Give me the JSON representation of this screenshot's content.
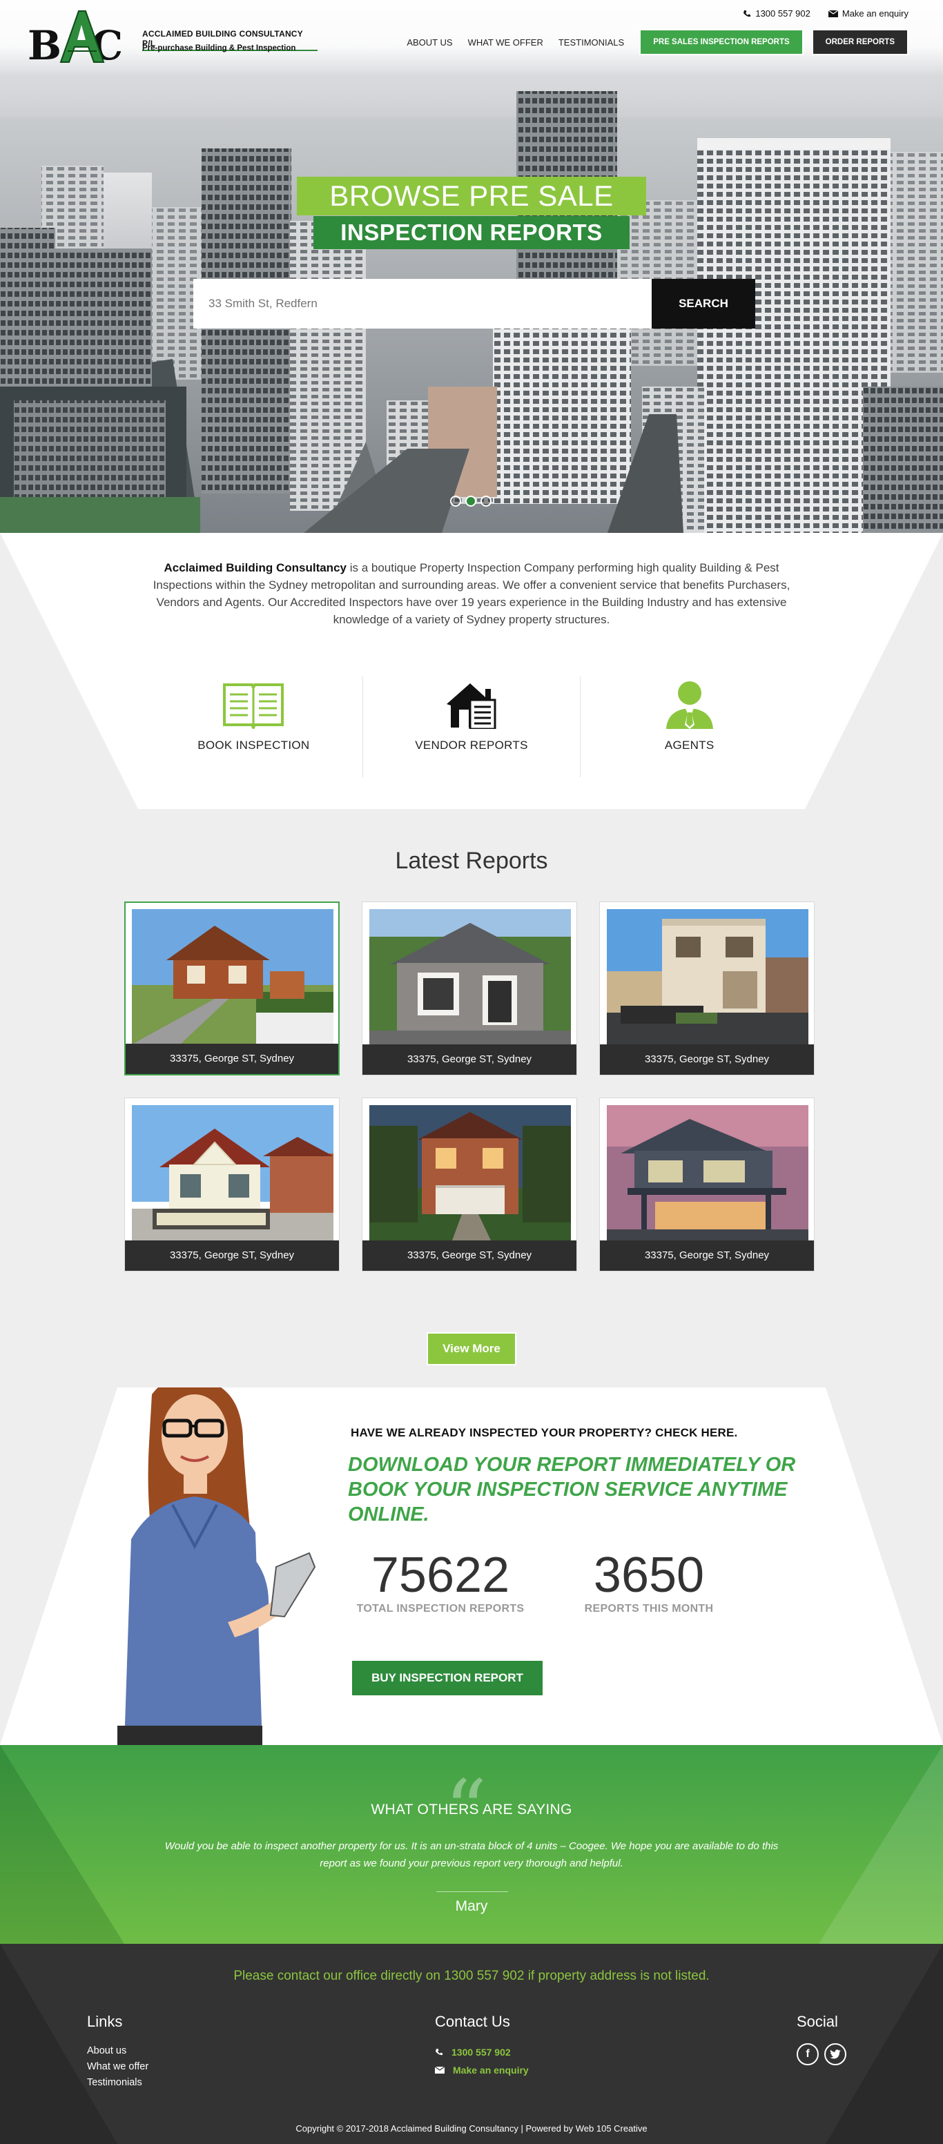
{
  "header": {
    "logo_text": "BAC",
    "company_name": "ACCLAIMED BUILDING CONSULTANCY  P/L",
    "tagline": "Pre-purchase Building & Pest Inspection",
    "phone": "1300 557 902",
    "enquiry": "Make an enquiry",
    "nav": [
      "ABOUT US",
      "WHAT WE OFFER",
      "TESTIMONIALS"
    ],
    "pre_sales_btn": "PRE SALES INSPECTION REPORTS",
    "order_btn": "ORDER REPORTS"
  },
  "hero": {
    "line1": "BROWSE PRE SALE",
    "line2": "INSPECTION REPORTS",
    "search_placeholder": "33 Smith St, Redfern",
    "search_button": "SEARCH",
    "slides": 3,
    "active_slide": 2
  },
  "intro": {
    "bold": "Acclaimed Building Consultancy",
    "text": " is a boutique Property Inspection Company performing high quality Building & Pest Inspections within the Sydney metropolitan and surrounding areas. We offer a convenient service that benefits Purchasers, Vendors and Agents. Our Accredited Inspectors have over 19 years experience in the Building Industry and has extensive knowledge of a variety of Sydney property structures."
  },
  "features": [
    {
      "label": "BOOK INSPECTION",
      "icon": "book-icon"
    },
    {
      "label": "VENDOR REPORTS",
      "icon": "house-document-icon"
    },
    {
      "label": "AGENTS",
      "icon": "agent-icon"
    }
  ],
  "reports": {
    "title": "Latest Reports",
    "items": [
      {
        "caption": "33375, George ST, Sydney"
      },
      {
        "caption": "33375, George ST, Sydney"
      },
      {
        "caption": "33375, George ST, Sydney"
      },
      {
        "caption": "33375, George ST, Sydney"
      },
      {
        "caption": "33375, George ST, Sydney"
      },
      {
        "caption": "33375, George ST, Sydney"
      }
    ],
    "view_more": "View More"
  },
  "check": {
    "question": "HAVE WE ALREADY INSPECTED YOUR PROPERTY?  CHECK HERE.",
    "headline": "DOWNLOAD YOUR REPORT IMMEDIATELY OR BOOK YOUR INSPECTION SERVICE ANYTIME ONLINE.",
    "stat1_value": "75622",
    "stat1_label": "TOTAL INSPECTION REPORTS",
    "stat2_value": "3650",
    "stat2_label": "REPORTS THIS MONTH",
    "buy_button": "BUY INSPECTION REPORT"
  },
  "testimonial": {
    "heading": "WHAT OTHERS ARE SAYING",
    "quote": "Would you be able to inspect another property for us. It is an un-strata block of 4 units – Coogee.  We hope you are available to do this report as we found your previous report very thorough and helpful.",
    "author": "Mary"
  },
  "footer": {
    "notice": "Please contact our office directly on 1300 557 902 if property address is not listed.",
    "links_title": "Links",
    "links": [
      "About us",
      "What we offer",
      "Testimonials"
    ],
    "contact_title": "Contact Us",
    "contact_phone": "1300 557 902",
    "contact_enquiry": "Make an enquiry",
    "social_title": "Social",
    "copyright": "Copyright © 2017-2018 Acclaimed Building Consultancy | Powered by Web 105 Creative"
  },
  "colors": {
    "green_primary": "#3fa549",
    "green_light": "#8cc63f",
    "green_dark": "#2e8b3c",
    "dark": "#2b2b2b"
  }
}
